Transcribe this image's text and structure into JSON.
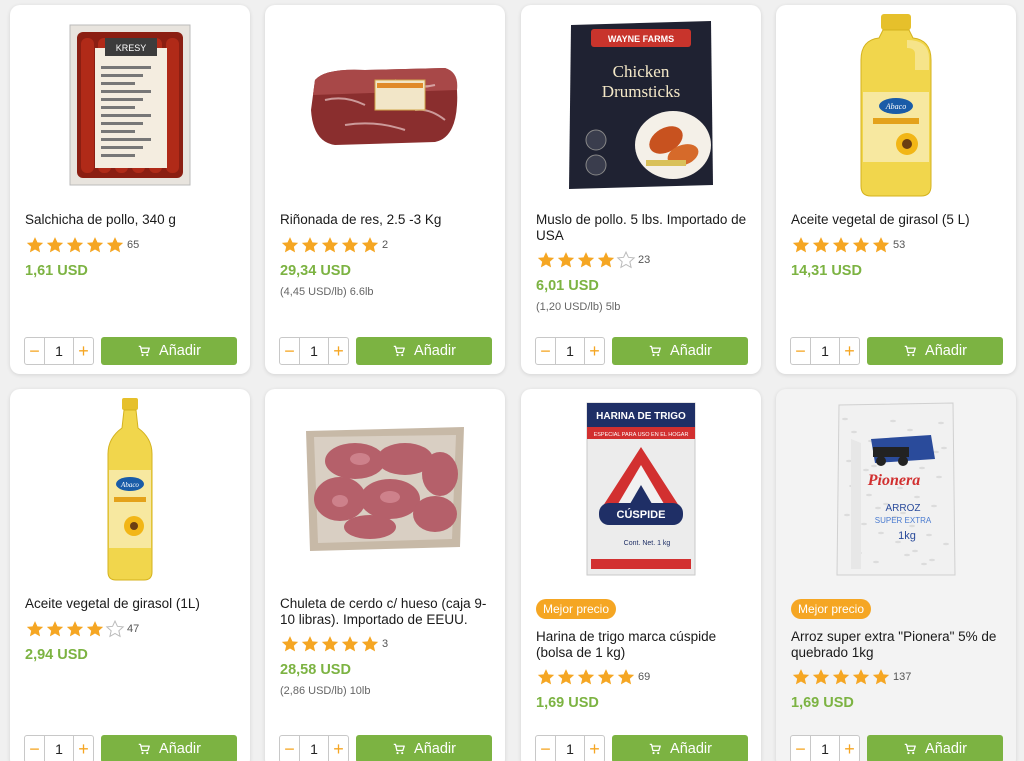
{
  "colors": {
    "accent_green": "#7cb342",
    "star_orange": "#f5a623",
    "badge_orange": "#f5a623"
  },
  "add_label": "Añadir",
  "products": [
    {
      "name": "Salchicha de pollo, 340 g",
      "stars": 5,
      "reviews": "65",
      "price": "1,61 USD",
      "unit_price": "",
      "qty": "1",
      "badge": "",
      "icon": "sausage-package-image"
    },
    {
      "name": "Riñonada de res, 2.5 -3 Kg",
      "stars": 5,
      "reviews": "2",
      "price": "29,34 USD",
      "unit_price": "(4,45 USD/lb) 6.6lb",
      "qty": "1",
      "badge": "",
      "icon": "beef-loin-image"
    },
    {
      "name": "Muslo de pollo. 5 lbs. Importado de USA",
      "stars": 4,
      "reviews": "23",
      "price": "6,01 USD",
      "unit_price": "(1,20 USD/lb) 5lb",
      "qty": "1",
      "badge": "",
      "icon": "chicken-drumsticks-bag-image"
    },
    {
      "name": "Aceite vegetal de girasol (5 L)",
      "stars": 5,
      "reviews": "53",
      "price": "14,31 USD",
      "unit_price": "",
      "qty": "1",
      "badge": "",
      "icon": "oil-jug-5l-image"
    },
    {
      "name": "Aceite vegetal de girasol (1L)",
      "stars": 4,
      "reviews": "47",
      "price": "2,94 USD",
      "unit_price": "",
      "qty": "1",
      "badge": "",
      "icon": "oil-bottle-1l-image"
    },
    {
      "name": "Chuleta de cerdo c/ hueso (caja 9-10 libras). Importado de EEUU.",
      "stars": 5,
      "reviews": "3",
      "price": "28,58 USD",
      "unit_price": "(2,86 USD/lb) 10lb",
      "qty": "1",
      "badge": "",
      "icon": "pork-chops-box-image"
    },
    {
      "name": "Harina de trigo marca cúspide (bolsa de 1 kg)",
      "stars": 5,
      "reviews": "69",
      "price": "1,69 USD",
      "unit_price": "",
      "qty": "1",
      "badge": "Mejor precio",
      "icon": "flour-bag-image"
    },
    {
      "name": "Arroz super extra \"Pionera\" 5% de quebrado 1kg",
      "stars": 5,
      "reviews": "137",
      "price": "1,69 USD",
      "unit_price": "",
      "qty": "1",
      "badge": "Mejor precio",
      "icon": "rice-bag-image"
    }
  ],
  "package_text": {
    "kresy": "KRESY",
    "wayne": "WAYNE FARMS",
    "drum1": "Chicken",
    "drum2": "Drumsticks",
    "abaco": "Abaco",
    "harina": "HARINA DE TRIGO",
    "harina_sub": "ESPECIAL PARA USO EN EL HOGAR",
    "cuspide": "CÚSPIDE",
    "cont": "Cont. Net. 1 kg",
    "pionera": "Pionera",
    "arroz": "ARROZ",
    "super": "SUPER EXTRA",
    "onekg": "1kg"
  }
}
